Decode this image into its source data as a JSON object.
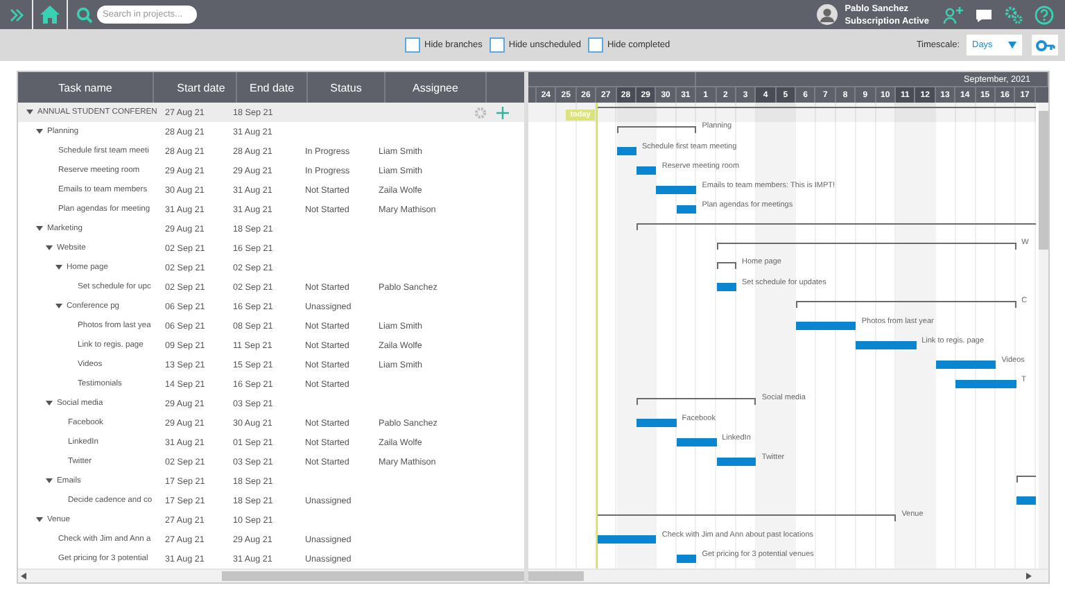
{
  "topbar": {
    "search_placeholder": "Search in projects...",
    "user_name": "Pablo Sanchez",
    "user_status": "Subscription Active"
  },
  "filters": [
    {
      "label": "Hide branches",
      "checked": false
    },
    {
      "label": "Hide unscheduled",
      "checked": false
    },
    {
      "label": "Hide completed",
      "checked": false
    }
  ],
  "timescale": {
    "label": "Timescale:",
    "value": "Days"
  },
  "table": {
    "columns": [
      "Task name",
      "Start date",
      "End date",
      "Status",
      "Assignee"
    ]
  },
  "chart": {
    "month_label": "September, 2021",
    "today_label": "today",
    "days": [
      {
        "label": "24",
        "weekend": false
      },
      {
        "label": "25",
        "weekend": false
      },
      {
        "label": "26",
        "weekend": false
      },
      {
        "label": "27",
        "weekend": false
      },
      {
        "label": "28",
        "weekend": true
      },
      {
        "label": "29",
        "weekend": true
      },
      {
        "label": "30",
        "weekend": false
      },
      {
        "label": "31",
        "weekend": false
      },
      {
        "label": "1",
        "weekend": false
      },
      {
        "label": "2",
        "weekend": false
      },
      {
        "label": "3",
        "weekend": false
      },
      {
        "label": "4",
        "weekend": true
      },
      {
        "label": "5",
        "weekend": true
      },
      {
        "label": "6",
        "weekend": false
      },
      {
        "label": "7",
        "weekend": false
      },
      {
        "label": "8",
        "weekend": false
      },
      {
        "label": "9",
        "weekend": false
      },
      {
        "label": "10",
        "weekend": false
      },
      {
        "label": "11",
        "weekend": true
      },
      {
        "label": "12",
        "weekend": true
      },
      {
        "label": "13",
        "weekend": false
      },
      {
        "label": "14",
        "weekend": false
      },
      {
        "label": "15",
        "weekend": false
      },
      {
        "label": "16",
        "weekend": false
      },
      {
        "label": "17",
        "weekend": false
      }
    ]
  },
  "rows": [
    {
      "kind": "summary",
      "name": "ANNUAL STUDENT CONFEREN",
      "start": "27 Aug 21",
      "end": "18 Sep 21",
      "selected": true,
      "expanded": true,
      "children": [
        {
          "kind": "summary",
          "name": "Planning",
          "start": "28 Aug 21",
          "end": "31 Aug 21",
          "bar_label": "Planning",
          "selected": false,
          "expanded": true,
          "children": [
            {
              "kind": "task",
              "name": "Schedule first team meeti",
              "start": "28 Aug 21",
              "end": "28 Aug 21",
              "status": "In Progress",
              "assignee": "Liam Smith",
              "bar_label": "Schedule first team meeting",
              "selected": false
            },
            {
              "kind": "task",
              "name": "Reserve meeting room",
              "start": "29 Aug 21",
              "end": "29 Aug 21",
              "status": "In Progress",
              "assignee": "Liam Smith",
              "bar_label": "Reserve meeting room",
              "selected": false
            },
            {
              "kind": "task",
              "name": "Emails to team members",
              "start": "30 Aug 21",
              "end": "31 Aug 21",
              "status": "Not Started",
              "assignee": "Zaila Wolfe",
              "bar_label": "Emails to team members: This is IMPT!",
              "selected": false
            },
            {
              "kind": "task",
              "name": "Plan agendas for meeting",
              "start": "31 Aug 21",
              "end": "31 Aug 21",
              "status": "Not Started",
              "assignee": "Mary Mathison",
              "bar_label": "Plan agendas for meetings",
              "selected": false
            }
          ]
        },
        {
          "kind": "summary",
          "name": "Marketing",
          "start": "29 Aug 21",
          "end": "18 Sep 21",
          "selected": false,
          "expanded": true,
          "children": [
            {
              "kind": "summary",
              "name": "Website",
              "start": "02 Sep 21",
              "end": "16 Sep 21",
              "bar_label": "W",
              "selected": false,
              "expanded": true,
              "children": [
                {
                  "kind": "summary",
                  "name": "Home page",
                  "start": "02 Sep 21",
                  "end": "02 Sep 21",
                  "bar_label": "Home page",
                  "selected": false,
                  "expanded": true,
                  "children": [
                    {
                      "kind": "task",
                      "name": "Set schedule for upc",
                      "start": "02 Sep 21",
                      "end": "02 Sep 21",
                      "status": "Not Started",
                      "assignee": "Pablo Sanchez",
                      "bar_label": "Set schedule for updates",
                      "selected": false
                    }
                  ]
                },
                {
                  "kind": "summary",
                  "name": "Conference pg",
                  "start": "06 Sep 21",
                  "end": "16 Sep 21",
                  "status": "Unassigned",
                  "bar_label": "C",
                  "selected": false,
                  "expanded": true,
                  "children": [
                    {
                      "kind": "task",
                      "name": "Photos from last yea",
                      "start": "06 Sep 21",
                      "end": "08 Sep 21",
                      "status": "Not Started",
                      "assignee": "Liam Smith",
                      "bar_label": "Photos from last year",
                      "selected": false
                    },
                    {
                      "kind": "task",
                      "name": "Link to regis. page",
                      "start": "09 Sep 21",
                      "end": "11 Sep 21",
                      "status": "Not Started",
                      "assignee": "Zaila Wolfe",
                      "bar_label": "Link to regis. page",
                      "selected": false
                    },
                    {
                      "kind": "task",
                      "name": "Videos",
                      "start": "13 Sep 21",
                      "end": "15 Sep 21",
                      "status": "Not Started",
                      "assignee": "Liam Smith",
                      "bar_label": "Videos",
                      "selected": false
                    },
                    {
                      "kind": "task",
                      "name": "Testimonials",
                      "start": "14 Sep 21",
                      "end": "16 Sep 21",
                      "status": "Not Started",
                      "bar_label": "T",
                      "selected": false
                    }
                  ]
                }
              ]
            },
            {
              "kind": "summary",
              "name": "Social media",
              "start": "29 Aug 21",
              "end": "03 Sep 21",
              "bar_label": "Social media",
              "selected": false,
              "expanded": true,
              "children": [
                {
                  "kind": "task",
                  "name": "Facebook",
                  "start": "29 Aug 21",
                  "end": "30 Aug 21",
                  "status": "Not Started",
                  "assignee": "Pablo Sanchez",
                  "bar_label": "Facebook",
                  "selected": false
                },
                {
                  "kind": "task",
                  "name": "LinkedIn",
                  "start": "31 Aug 21",
                  "end": "01 Sep 21",
                  "status": "Not Started",
                  "assignee": "Zaila Wolfe",
                  "bar_label": "LinkedIn",
                  "selected": false
                },
                {
                  "kind": "task",
                  "name": "Twitter",
                  "start": "02 Sep 21",
                  "end": "03 Sep 21",
                  "status": "Not Started",
                  "assignee": "Mary Mathison",
                  "bar_label": "Twitter",
                  "selected": false
                }
              ]
            },
            {
              "kind": "summary",
              "name": "Emails",
              "start": "17 Sep 21",
              "end": "18 Sep 21",
              "selected": false,
              "expanded": true,
              "children": [
                {
                  "kind": "task",
                  "name": "Decide cadence and co",
                  "start": "17 Sep 21",
                  "end": "18 Sep 21",
                  "status": "Unassigned",
                  "selected": false
                }
              ]
            }
          ]
        },
        {
          "kind": "summary",
          "name": "Venue",
          "start": "27 Aug 21",
          "end": "10 Sep 21",
          "bar_label": "Venue",
          "selected": false,
          "expanded": true,
          "children": [
            {
              "kind": "task",
              "name": "Check with Jim and Ann a",
              "start": "27 Aug 21",
              "end": "29 Aug 21",
              "status": "Unassigned",
              "bar_label": "Check with Jim and Ann about past locations",
              "selected": false
            },
            {
              "kind": "task",
              "name": "Get pricing for 3 potential",
              "start": "31 Aug 21",
              "end": "31 Aug 21",
              "status": "Unassigned",
              "bar_label": "Get pricing for 3 potential venues",
              "selected": false
            }
          ]
        }
      ]
    }
  ]
}
